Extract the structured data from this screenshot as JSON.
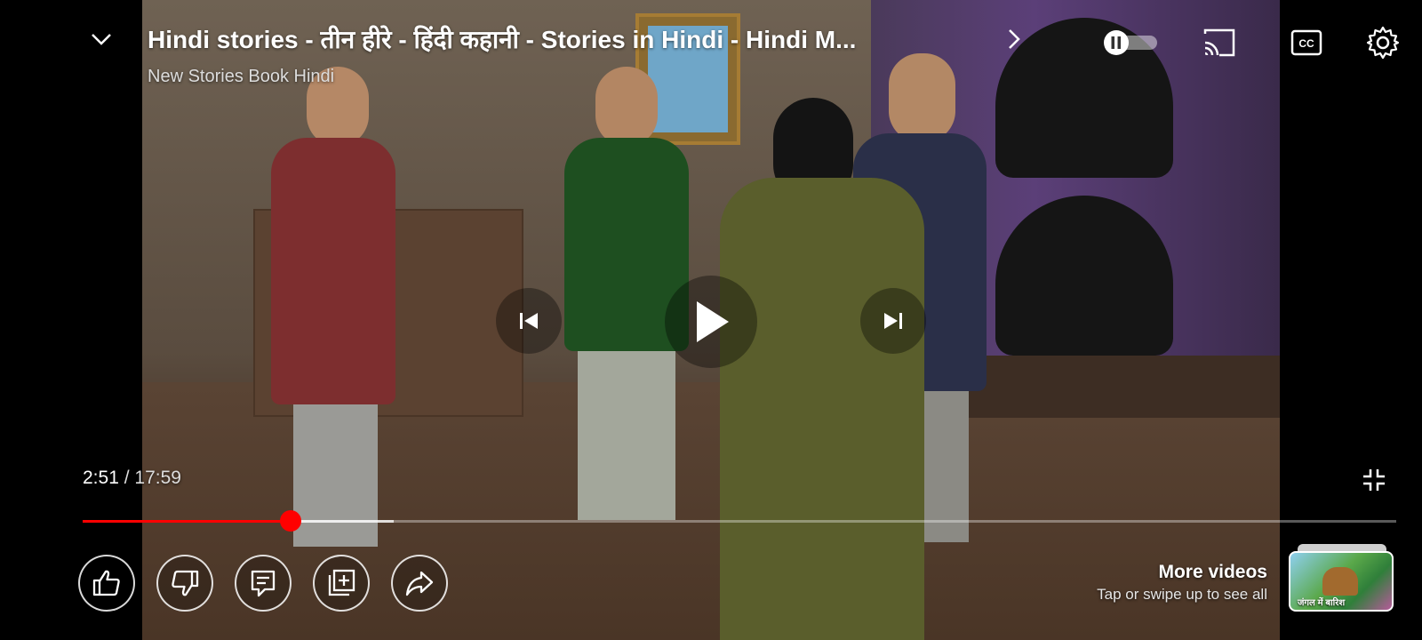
{
  "header": {
    "title": "Hindi stories - तीन हीरे - हिंदी कहानी - Stories in Hindi - Hindi M...",
    "channel": "New Stories Book Hindi"
  },
  "player": {
    "current_time": "2:51",
    "separator": "/",
    "duration": "17:59",
    "progress_fraction": 0.158,
    "buffered_fraction": 0.237
  },
  "more_videos": {
    "title": "More videos",
    "subtitle": "Tap or swipe up to see all",
    "thumbnail_text": "जंगल में बारिश"
  },
  "icons": {
    "collapse": "chevron-down-icon",
    "title_arrow": "chevron-right-icon",
    "autoplay": "autoplay-toggle-icon",
    "cast": "cast-icon",
    "captions": "cc-icon",
    "settings": "gear-icon",
    "previous": "skip-previous-icon",
    "play": "play-icon",
    "next": "skip-next-icon",
    "exit_fullscreen": "exit-fullscreen-icon",
    "like": "thumbs-up-icon",
    "dislike": "thumbs-down-icon",
    "comments": "comment-icon",
    "save": "add-to-playlist-icon",
    "share": "share-icon"
  },
  "colors": {
    "progress": "#ff0000",
    "background": "#000000"
  }
}
